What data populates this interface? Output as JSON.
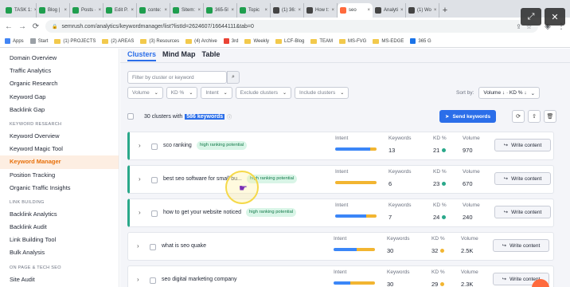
{
  "browser": {
    "tabs": [
      {
        "label": "TASK 1:",
        "color": "#1f9e4e"
      },
      {
        "label": "Blog |",
        "color": "#1f9e4e"
      },
      {
        "label": "Posts ·",
        "color": "#1f9e4e"
      },
      {
        "label": "Edit P.",
        "color": "#1f9e4e"
      },
      {
        "label": "conte:",
        "color": "#1f9e4e"
      },
      {
        "label": "Sitem:",
        "color": "#1f9e4e"
      },
      {
        "label": "365-5l",
        "color": "#1f9e4e"
      },
      {
        "label": "Topic",
        "color": "#1f9e4e"
      },
      {
        "label": "(1) 36:",
        "color": "#444444"
      },
      {
        "label": "How t:",
        "color": "#444444"
      },
      {
        "label": "seo",
        "color": "#ff6a3d",
        "active": true
      },
      {
        "label": "Analyti",
        "color": "#444444"
      },
      {
        "label": "(1) Wo",
        "color": "#444444"
      }
    ],
    "url": "semrush.com/analytics/keywordmanager/list?listId=2624607/16644111&tab=0",
    "bookmarks": [
      {
        "label": "Apps",
        "type": "grid"
      },
      {
        "label": "Start",
        "type": "file"
      },
      {
        "label": "(1) PROJECTS",
        "type": "folder"
      },
      {
        "label": "(2) AREAS",
        "type": "folder"
      },
      {
        "label": "(3) Resources",
        "type": "folder"
      },
      {
        "label": "(4) Archive",
        "type": "folder"
      },
      {
        "label": "3rd",
        "type": "google"
      },
      {
        "label": "Weekly",
        "type": "folder"
      },
      {
        "label": "LCF-Blog",
        "type": "folder"
      },
      {
        "label": "TEAM",
        "type": "folder"
      },
      {
        "label": "MS-FVG",
        "type": "folder"
      },
      {
        "label": "MS-EDGE",
        "type": "folder"
      },
      {
        "label": "365 G",
        "type": "blue"
      }
    ]
  },
  "sidebar": {
    "items": [
      {
        "label": "Domain Overview"
      },
      {
        "label": "Traffic Analytics"
      },
      {
        "label": "Organic Research"
      },
      {
        "label": "Keyword Gap"
      },
      {
        "label": "Backlink Gap"
      }
    ],
    "section_keyword": "KEYWORD RESEARCH",
    "keyword_items": [
      {
        "label": "Keyword Overview"
      },
      {
        "label": "Keyword Magic Tool"
      },
      {
        "label": "Keyword Manager",
        "active": true
      },
      {
        "label": "Position Tracking"
      },
      {
        "label": "Organic Traffic Insights"
      }
    ],
    "section_link": "LINK BUILDING",
    "link_items": [
      {
        "label": "Backlink Analytics"
      },
      {
        "label": "Backlink Audit"
      },
      {
        "label": "Link Building Tool"
      },
      {
        "label": "Bulk Analysis"
      }
    ],
    "section_onpage": "ON PAGE & TECH SEO",
    "onpage_items": [
      {
        "label": "Site Audit"
      }
    ]
  },
  "main": {
    "view_tabs": [
      {
        "label": "Clusters",
        "active": true
      },
      {
        "label": "Mind Map"
      },
      {
        "label": "Table"
      }
    ],
    "filter_placeholder": "Filter by cluster or keyword",
    "filters": [
      "Volume",
      "KD %",
      "Intent",
      "Exclude clusters",
      "Include clusters"
    ],
    "sort_label": "Sort by:",
    "sort_value": "Volume ↓ · KD % ↓",
    "summary_prefix": "30 clusters with",
    "summary_highlight": "586 keywords",
    "send_button": "Send keywords",
    "col_intent": "Intent",
    "col_keywords": "Keywords",
    "col_kd": "KD %",
    "col_volume": "Volume",
    "write_label": "Write content",
    "clusters": [
      {
        "name": "sco ranking",
        "badge": "high ranking potential",
        "keywords": "13",
        "kd": "21",
        "kd_color": "#2aa88a",
        "volume": "970",
        "intent": [
          0.85,
          0.15
        ],
        "accent": true
      },
      {
        "name": "best seo software for small bu...",
        "badge": "high ranking potential",
        "keywords": "6",
        "kd": "23",
        "kd_color": "#2aa88a",
        "volume": "670",
        "intent": [
          0.0,
          1.0
        ],
        "accent": true
      },
      {
        "name": "how to get your website noticed",
        "badge": "high ranking potential",
        "keywords": "7",
        "kd": "24",
        "kd_color": "#2aa88a",
        "volume": "240",
        "intent": [
          0.75,
          0.25
        ],
        "accent": true
      },
      {
        "name": "what is seo quake",
        "badge": "",
        "keywords": "30",
        "kd": "32",
        "kd_color": "#f2b531",
        "volume": "2.5K",
        "intent": [
          0.55,
          0.45
        ],
        "accent": false
      },
      {
        "name": "seo digital marketing company",
        "badge": "",
        "keywords": "30",
        "kd": "29",
        "kd_color": "#f2b531",
        "volume": "2.3K",
        "intent": [
          0.4,
          0.6
        ],
        "accent": false
      }
    ],
    "colors": {
      "informational": "#3b86f7",
      "commercial": "#f2b531",
      "accent": "#2aa88a",
      "brand": "#2b6ee9"
    }
  }
}
